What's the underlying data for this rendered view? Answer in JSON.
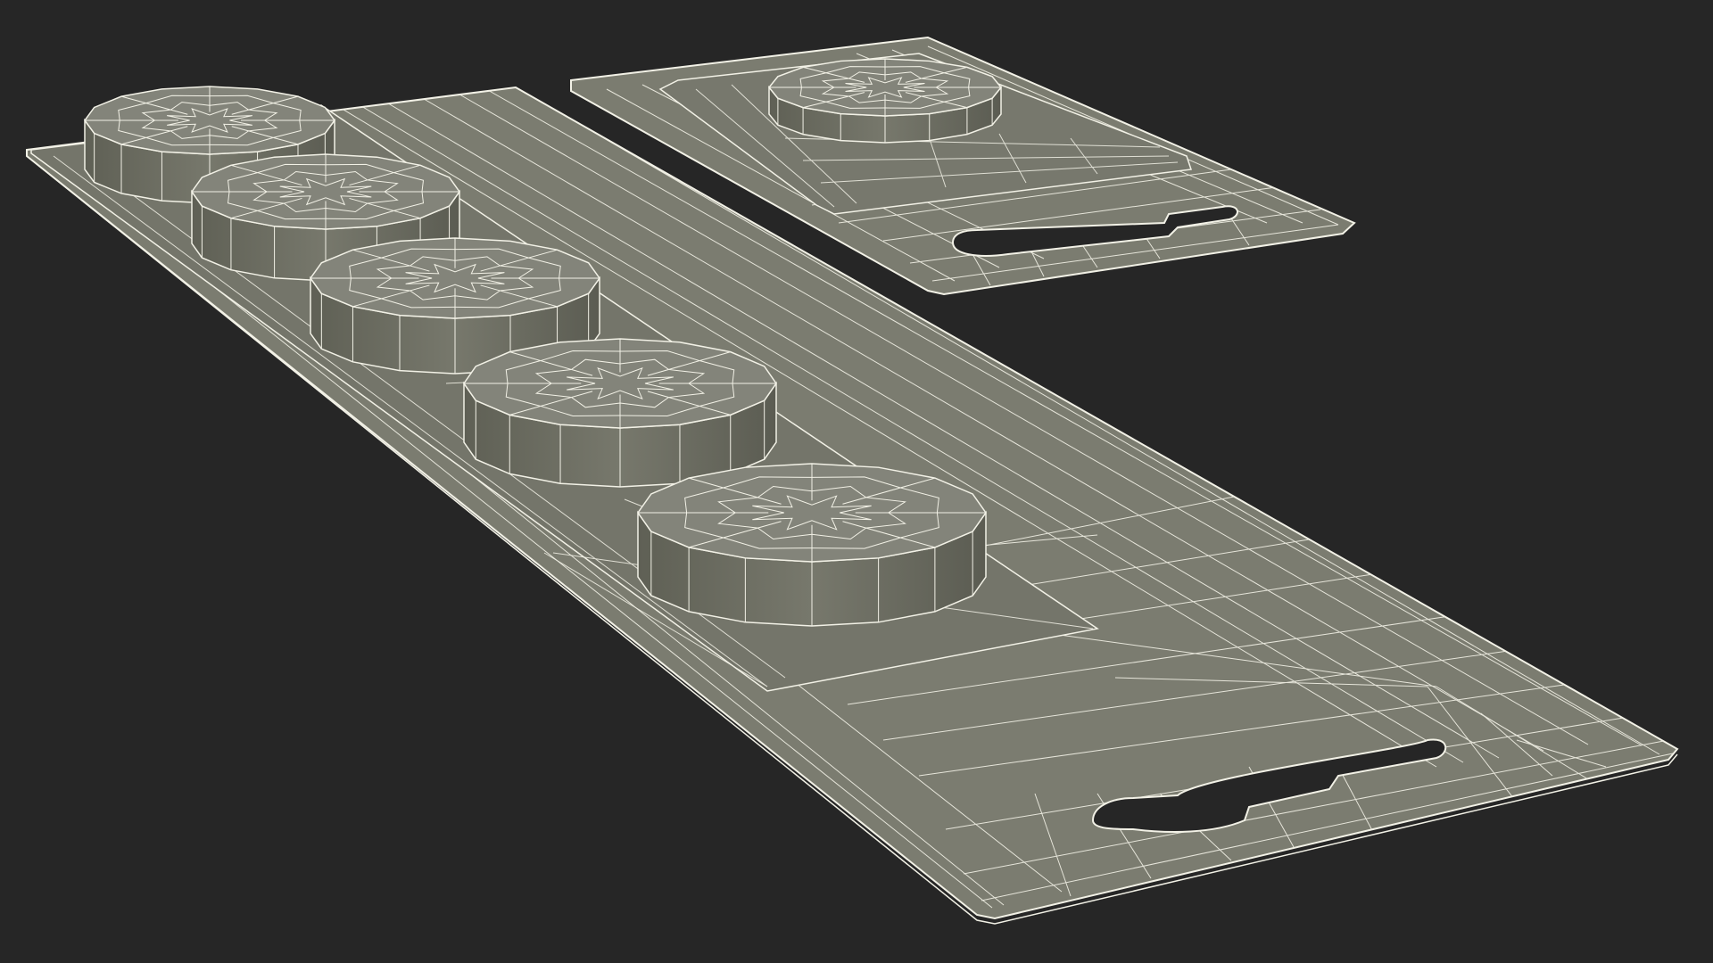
{
  "scene": {
    "subject": "wireframe-blister-packs",
    "colors": {
      "background": "#262626",
      "surface": "#7b7c70",
      "surface_dark": "#6e6f64",
      "cylinder_side": "#6d6e62",
      "cylinder_top": "#83847a",
      "wire": "#f2f1e6"
    }
  }
}
